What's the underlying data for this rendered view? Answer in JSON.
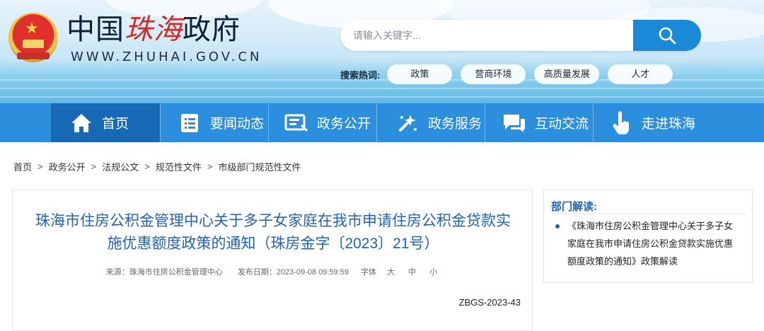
{
  "header": {
    "logo_text_black_1": "中国",
    "logo_text_red": "珠海",
    "logo_text_black_2": "政府",
    "logo_url_text": "WWW.ZHUHAI.GOV.CN",
    "search": {
      "placeholder": "请输入关键字...",
      "value": ""
    },
    "hot_label": "搜索热词:",
    "hot_terms": [
      "政策",
      "营商环境",
      "高质量发展",
      "人才"
    ]
  },
  "nav": {
    "items": [
      {
        "label": "首页",
        "icon": "home-icon",
        "active": true
      },
      {
        "label": "要闻动态",
        "icon": "news-list-icon"
      },
      {
        "label": "政务公开",
        "icon": "document-icon"
      },
      {
        "label": "政务服务",
        "icon": "service-icon"
      },
      {
        "label": "互动交流",
        "icon": "chat-icon"
      },
      {
        "label": "走进珠海",
        "icon": "hand-pointer-icon"
      }
    ]
  },
  "breadcrumb": [
    "首页",
    "政务公开",
    "法规公文",
    "规范性文件",
    "市级部门规范性文件"
  ],
  "breadcrumb_sep": ">",
  "article": {
    "title_line1": "珠海市住房公积金管理中心关于多子女家庭在我市申请住房公积金贷款实",
    "title_line2": "施优惠额度政策的通知（珠房金字〔2023〕21号）",
    "source_label": "来源：",
    "source": "珠海市住房公积金管理中心",
    "date_label": "发布日期：",
    "date": "2023-09-08 09:59:59",
    "font_label": "字体",
    "font_large": "大",
    "font_medium": "中",
    "font_small": "小",
    "doc_number": "ZBGS-2023-43"
  },
  "sidebar": {
    "title": "部门解读:",
    "link": "《珠海市住房公积金管理中心关于多子女家庭在我市申请住房公积金贷款实施优惠额度政策的通知》政策解读"
  },
  "colors": {
    "nav_bg": "#2b8fde",
    "nav_active": "#1769b6",
    "title_blue": "#1d63b8",
    "search_btn": "#1a8ad6",
    "logo_red": "#d22b27"
  }
}
